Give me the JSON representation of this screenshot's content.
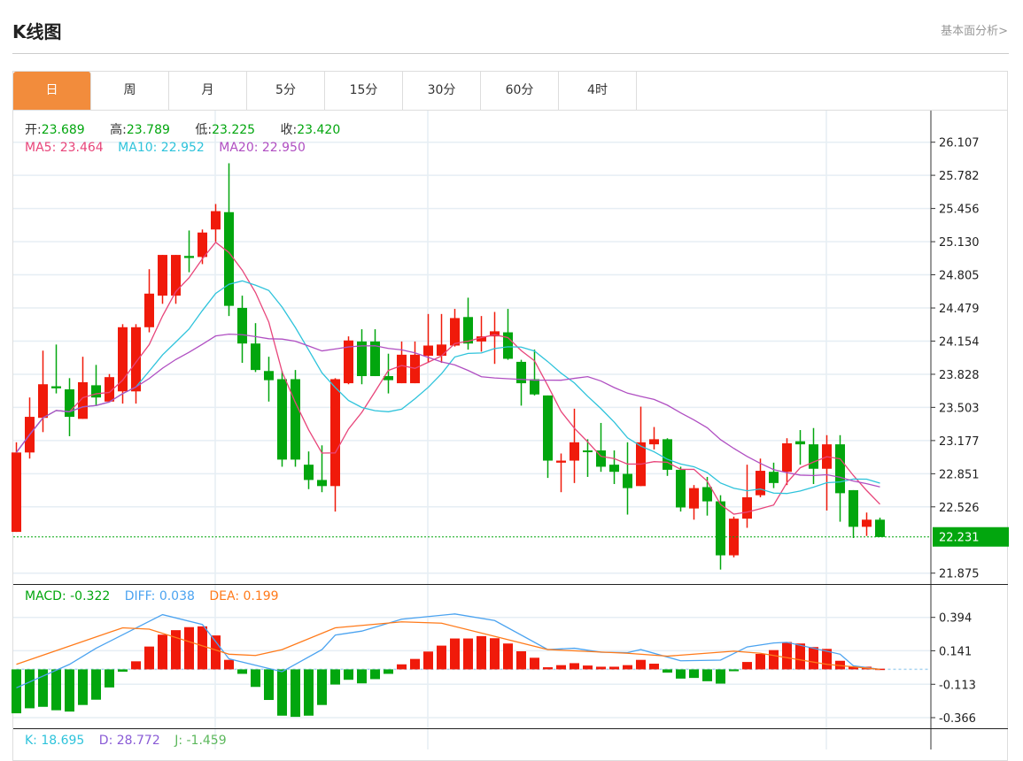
{
  "header": {
    "title": "K线图",
    "link": "基本面分析>"
  },
  "tabs": [
    {
      "label": "日",
      "active": true
    },
    {
      "label": "周"
    },
    {
      "label": "月"
    },
    {
      "label": "5分"
    },
    {
      "label": "15分"
    },
    {
      "label": "30分"
    },
    {
      "label": "60分"
    },
    {
      "label": "4时"
    }
  ],
  "ohlc_info": {
    "open_label": "开:",
    "open": "23.689",
    "high_label": "高:",
    "high": "23.789",
    "low_label": "低:",
    "low": "23.225",
    "close_label": "收:",
    "close": "23.420"
  },
  "ma_info": {
    "ma5": "MA5: 23.464",
    "ma10": "MA10: 22.952",
    "ma20": "MA20: 22.950"
  },
  "macd_info": {
    "macd": "MACD: -0.322",
    "diff": "DIFF: 0.038",
    "dea": "DEA: 0.199"
  },
  "kdj_info": {
    "k": "K: 18.695",
    "d": "D: 28.772",
    "j": "J: -1.459"
  },
  "colors": {
    "up": "#F01A0A",
    "down": "#02A60E",
    "accent": "#F28C3C",
    "ma5": "#E8457A",
    "ma10": "#2EC3DB",
    "ma20": "#B04FC2",
    "diff": "#4BA3F0",
    "dea": "#FF7A1A"
  },
  "chart_data": {
    "type": "candlestick",
    "y_ticks": [
      "26.107",
      "25.782",
      "25.456",
      "25.130",
      "24.805",
      "24.479",
      "24.154",
      "23.828",
      "23.503",
      "23.177",
      "22.851",
      "22.526",
      "21.875"
    ],
    "ylim": [
      21.875,
      26.107
    ],
    "last_price": "22.231",
    "candles": [
      [
        22.28,
        23.16,
        22.28,
        23.06
      ],
      [
        23.06,
        23.6,
        23.0,
        23.41
      ],
      [
        23.4,
        24.06,
        23.26,
        23.73
      ],
      [
        23.71,
        24.12,
        23.64,
        23.69
      ],
      [
        23.68,
        23.79,
        23.22,
        23.41
      ],
      [
        23.39,
        24.0,
        23.39,
        23.75
      ],
      [
        23.72,
        23.92,
        23.52,
        23.6
      ],
      [
        23.56,
        23.83,
        23.56,
        23.8
      ],
      [
        23.66,
        24.32,
        23.54,
        24.29
      ],
      [
        23.66,
        24.32,
        23.54,
        24.29
      ],
      [
        24.29,
        24.86,
        24.24,
        24.62
      ],
      [
        24.6,
        25.0,
        24.52,
        25.0
      ],
      [
        24.6,
        25.0,
        24.52,
        25.0
      ],
      [
        24.99,
        25.24,
        24.83,
        24.97
      ],
      [
        24.98,
        25.25,
        24.91,
        25.22
      ],
      [
        25.25,
        25.5,
        25.13,
        25.43
      ],
      [
        25.42,
        25.9,
        24.4,
        24.5
      ],
      [
        24.48,
        24.6,
        23.94,
        24.13
      ],
      [
        24.13,
        24.33,
        23.85,
        23.87
      ],
      [
        23.86,
        24.0,
        23.56,
        23.77
      ],
      [
        23.78,
        23.86,
        22.92,
        22.99
      ],
      [
        23.78,
        23.87,
        22.92,
        22.99
      ],
      [
        22.94,
        23.07,
        22.7,
        22.79
      ],
      [
        22.79,
        23.13,
        22.67,
        22.73
      ],
      [
        22.73,
        23.79,
        22.48,
        23.78
      ],
      [
        23.74,
        24.2,
        23.73,
        24.16
      ],
      [
        24.15,
        24.27,
        23.73,
        23.81
      ],
      [
        24.15,
        24.27,
        23.81,
        23.81
      ],
      [
        23.81,
        24.03,
        23.64,
        23.77
      ],
      [
        23.74,
        24.15,
        23.74,
        24.02
      ],
      [
        23.74,
        24.15,
        23.74,
        24.02
      ],
      [
        24.01,
        24.42,
        23.94,
        24.11
      ],
      [
        24.01,
        24.42,
        23.94,
        24.12
      ],
      [
        24.11,
        24.47,
        24.1,
        24.38
      ],
      [
        24.39,
        24.58,
        24.07,
        24.13
      ],
      [
        24.15,
        24.4,
        24.05,
        24.2
      ],
      [
        24.2,
        24.44,
        23.93,
        24.25
      ],
      [
        24.24,
        24.47,
        23.97,
        23.98
      ],
      [
        23.95,
        23.97,
        23.52,
        23.74
      ],
      [
        23.78,
        24.07,
        23.62,
        23.63
      ],
      [
        23.62,
        23.62,
        22.81,
        22.98
      ],
      [
        22.96,
        23.05,
        22.67,
        22.98
      ],
      [
        22.98,
        23.49,
        22.76,
        23.16
      ],
      [
        23.08,
        23.19,
        22.82,
        23.07
      ],
      [
        23.08,
        23.35,
        22.87,
        22.92
      ],
      [
        22.94,
        23.08,
        22.75,
        22.87
      ],
      [
        22.85,
        23.16,
        22.45,
        22.71
      ],
      [
        22.73,
        23.51,
        22.73,
        23.16
      ],
      [
        23.14,
        23.31,
        23.09,
        23.19
      ],
      [
        23.19,
        23.2,
        22.83,
        22.89
      ],
      [
        22.89,
        22.92,
        22.48,
        22.52
      ],
      [
        22.51,
        22.74,
        22.4,
        22.71
      ],
      [
        22.72,
        22.82,
        22.44,
        22.58
      ],
      [
        22.58,
        22.64,
        21.91,
        22.05
      ],
      [
        22.05,
        22.43,
        22.03,
        22.41
      ],
      [
        22.41,
        22.94,
        22.32,
        22.62
      ],
      [
        22.64,
        23.0,
        22.62,
        22.88
      ],
      [
        22.87,
        22.96,
        22.71,
        22.76
      ],
      [
        22.87,
        23.2,
        22.74,
        23.15
      ],
      [
        23.17,
        23.28,
        22.94,
        23.14
      ],
      [
        23.14,
        23.3,
        22.75,
        22.9
      ],
      [
        22.9,
        23.23,
        22.49,
        23.14
      ],
      [
        23.14,
        23.23,
        22.38,
        22.66
      ],
      [
        22.69,
        22.69,
        22.22,
        22.33
      ],
      [
        22.33,
        22.47,
        22.24,
        22.4
      ],
      [
        22.4,
        22.42,
        22.23,
        22.23
      ]
    ],
    "macd": {
      "y_ticks": [
        "0.394",
        "0.141",
        "-0.113",
        "-0.366"
      ],
      "ylim": [
        -0.366,
        0.394
      ],
      "hist": [
        -0.333,
        -0.295,
        -0.284,
        -0.31,
        -0.32,
        -0.27,
        -0.23,
        -0.137,
        -0.018,
        0.061,
        0.173,
        0.263,
        0.297,
        0.32,
        0.326,
        0.257,
        0.072,
        -0.034,
        -0.133,
        -0.232,
        -0.351,
        -0.36,
        -0.351,
        -0.27,
        -0.115,
        -0.079,
        -0.106,
        -0.074,
        -0.034,
        0.038,
        0.079,
        0.135,
        0.18,
        0.234,
        0.234,
        0.252,
        0.236,
        0.196,
        0.137,
        0.088,
        0.016,
        0.032,
        0.047,
        0.029,
        0.02,
        0.02,
        0.032,
        0.072,
        0.043,
        -0.025,
        -0.07,
        -0.065,
        -0.09,
        -0.108,
        -0.014,
        0.056,
        0.117,
        0.146,
        0.207,
        0.196,
        0.169,
        0.155,
        0.065,
        0.02,
        0.02,
        0.005
      ],
      "diff": [
        [
          0,
          -0.14
        ],
        [
          4,
          0.038
        ],
        [
          6,
          0.16
        ],
        [
          11,
          0.415
        ],
        [
          14,
          0.34
        ],
        [
          16,
          0.08
        ],
        [
          20,
          -0.018
        ],
        [
          23,
          0.15
        ],
        [
          24,
          0.26
        ],
        [
          26,
          0.29
        ],
        [
          29,
          0.38
        ],
        [
          33,
          0.42
        ],
        [
          36,
          0.37
        ],
        [
          40,
          0.15
        ],
        [
          42,
          0.16
        ],
        [
          44,
          0.13
        ],
        [
          46,
          0.127
        ],
        [
          47,
          0.15
        ],
        [
          50,
          0.065
        ],
        [
          53,
          0.07
        ],
        [
          55,
          0.17
        ],
        [
          57,
          0.2
        ],
        [
          58,
          0.205
        ],
        [
          62,
          0.115
        ],
        [
          63,
          0.027
        ],
        [
          65,
          0.0
        ]
      ],
      "dea": [
        [
          0,
          0.038
        ],
        [
          8,
          0.315
        ],
        [
          10,
          0.305
        ],
        [
          16,
          0.115
        ],
        [
          18,
          0.105
        ],
        [
          20,
          0.15
        ],
        [
          24,
          0.315
        ],
        [
          29,
          0.36
        ],
        [
          32,
          0.35
        ],
        [
          36,
          0.25
        ],
        [
          40,
          0.15
        ],
        [
          46,
          0.122
        ],
        [
          49,
          0.1
        ],
        [
          54,
          0.138
        ],
        [
          56,
          0.122
        ],
        [
          61,
          0.038
        ],
        [
          65,
          0.0
        ]
      ]
    }
  }
}
